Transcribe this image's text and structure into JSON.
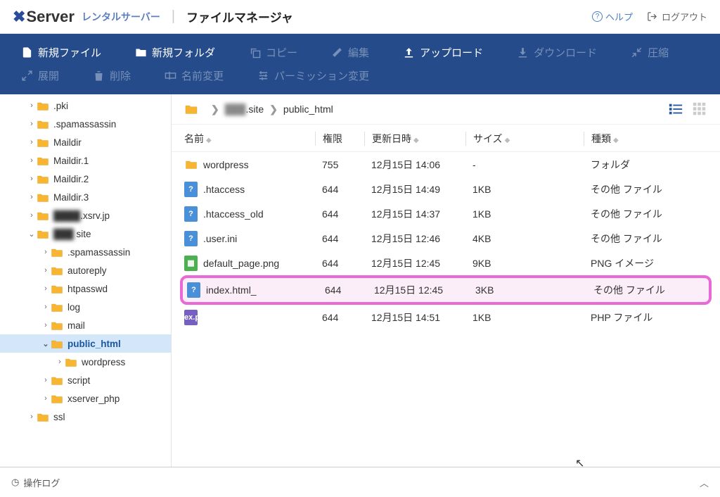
{
  "header": {
    "brand_main": "Server",
    "brand_sub": "レンタルサーバー",
    "app_title": "ファイルマネージャ",
    "help": "ヘルプ",
    "logout": "ログアウト"
  },
  "toolbar": {
    "row1": [
      {
        "label": "新規ファイル",
        "disabled": false,
        "icon": "file-plus"
      },
      {
        "label": "新規フォルダ",
        "disabled": false,
        "icon": "folder-plus"
      },
      {
        "label": "コピー",
        "disabled": true,
        "icon": "copy"
      },
      {
        "label": "編集",
        "disabled": true,
        "icon": "edit"
      },
      {
        "label": "アップロード",
        "disabled": false,
        "icon": "upload"
      },
      {
        "label": "ダウンロード",
        "disabled": true,
        "icon": "download"
      },
      {
        "label": "圧縮",
        "disabled": true,
        "icon": "compress"
      }
    ],
    "row2": [
      {
        "label": "展開",
        "disabled": true,
        "icon": "expand"
      },
      {
        "label": "削除",
        "disabled": true,
        "icon": "trash"
      },
      {
        "label": "名前変更",
        "disabled": true,
        "icon": "rename"
      },
      {
        "label": "パーミッション変更",
        "disabled": true,
        "icon": "permission"
      }
    ]
  },
  "tree": [
    {
      "label": ".pki",
      "depth": 1,
      "open": false,
      "active": false
    },
    {
      "label": ".spamassassin",
      "depth": 1,
      "open": false,
      "active": false
    },
    {
      "label": "Maildir",
      "depth": 1,
      "open": false,
      "active": false
    },
    {
      "label": "Maildir.1",
      "depth": 1,
      "open": false,
      "active": false
    },
    {
      "label": "Maildir.2",
      "depth": 1,
      "open": false,
      "active": false
    },
    {
      "label": "Maildir.3",
      "depth": 1,
      "open": false,
      "active": false
    },
    {
      "label": ".xsrv.jp",
      "depth": 1,
      "open": false,
      "active": false,
      "blur": true,
      "prefix": "████"
    },
    {
      "label": " site",
      "depth": 1,
      "open": true,
      "active": false,
      "blur": true,
      "prefix": "███"
    },
    {
      "label": ".spamassassin",
      "depth": 2,
      "open": false,
      "active": false
    },
    {
      "label": "autoreply",
      "depth": 2,
      "open": false,
      "active": false
    },
    {
      "label": "htpasswd",
      "depth": 2,
      "open": false,
      "active": false
    },
    {
      "label": "log",
      "depth": 2,
      "open": false,
      "active": false
    },
    {
      "label": "mail",
      "depth": 2,
      "open": false,
      "active": false
    },
    {
      "label": "public_html",
      "depth": 2,
      "open": true,
      "active": true
    },
    {
      "label": "wordpress",
      "depth": 3,
      "open": false,
      "active": false
    },
    {
      "label": "script",
      "depth": 2,
      "open": false,
      "active": false
    },
    {
      "label": "xserver_php",
      "depth": 2,
      "open": false,
      "active": false
    },
    {
      "label": "ssl",
      "depth": 1,
      "open": false,
      "active": false
    }
  ],
  "breadcrumb": {
    "items": [
      {
        "text": "███ site",
        "blur": true
      },
      {
        "text": "public_html",
        "blur": false
      }
    ]
  },
  "columns": {
    "name": "名前",
    "perm": "権限",
    "date": "更新日時",
    "size": "サイズ",
    "type": "種類"
  },
  "files": [
    {
      "name": "wordpress",
      "perm": "755",
      "date": "12月15日 14:06",
      "size": "-",
      "type": "フォルダ",
      "icon": "folder",
      "color": "#f7b531",
      "highlight": false
    },
    {
      "name": ".htaccess",
      "perm": "644",
      "date": "12月15日 14:49",
      "size": "1KB",
      "type": "その他 ファイル",
      "icon": "?",
      "color": "#4a90d9",
      "highlight": false
    },
    {
      "name": ".htaccess_old",
      "perm": "644",
      "date": "12月15日 14:37",
      "size": "1KB",
      "type": "その他 ファイル",
      "icon": "?",
      "color": "#4a90d9",
      "highlight": false
    },
    {
      "name": ".user.ini",
      "perm": "644",
      "date": "12月15日 12:46",
      "size": "4KB",
      "type": "その他 ファイル",
      "icon": "?",
      "color": "#4a90d9",
      "highlight": false
    },
    {
      "name": "default_page.png",
      "perm": "644",
      "date": "12月15日 12:45",
      "size": "9KB",
      "type": "PNG イメージ",
      "icon": "▦",
      "color": "#4cb050",
      "highlight": false
    },
    {
      "name": "index.html_",
      "perm": "644",
      "date": "12月15日 12:45",
      "size": "3KB",
      "type": "その他 ファイル",
      "icon": "?",
      "color": "#4a90d9",
      "highlight": true
    },
    {
      "name": "index.php",
      "perm": "644",
      "date": "12月15日 14:51",
      "size": "1KB",
      "type": "PHP ファイル",
      "icon": "<?",
      "color": "#7560c0",
      "highlight": false
    }
  ],
  "footer": {
    "ops_log": "操作ログ"
  }
}
